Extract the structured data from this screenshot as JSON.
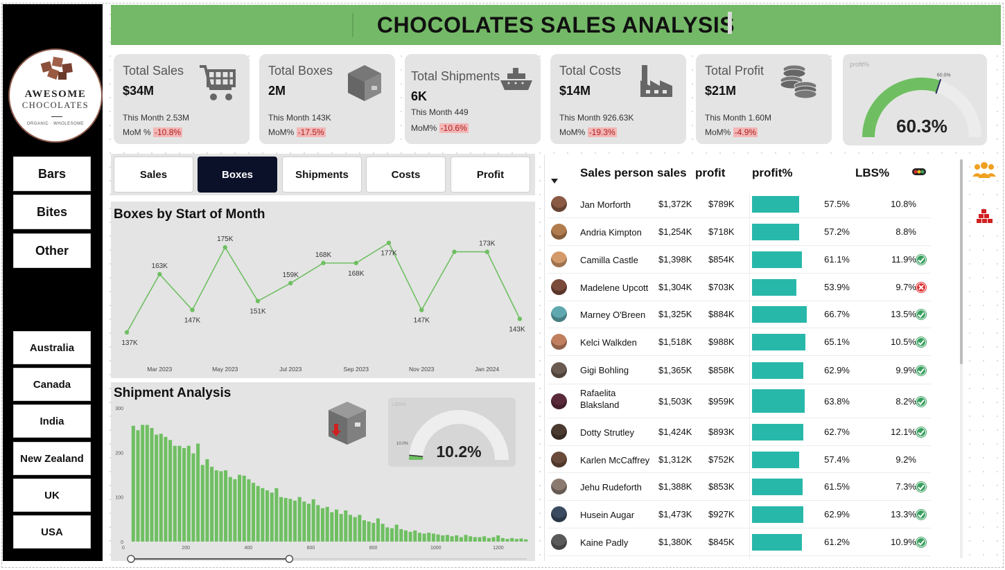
{
  "header": {
    "title": "CHOCOLATES SALES ANALYSIS"
  },
  "logo": {
    "line1": "AWESOME",
    "line2": "CHOCOLATES",
    "tagline": "ORGANIC · WHOLESOME"
  },
  "sidebar": {
    "products": [
      "Bars",
      "Bites",
      "Other"
    ],
    "countries": [
      "Australia",
      "Canada",
      "India",
      "New Zealand",
      "UK",
      "USA"
    ]
  },
  "kpis": [
    {
      "title": "Total Sales",
      "value": "$34M",
      "month_label": "This Month",
      "month_value": "2.53M",
      "mom_label": "MoM %",
      "mom_value": "-10.8%",
      "icon": "cart-icon"
    },
    {
      "title": "Total Boxes",
      "value": "2M",
      "month_label": "This Month",
      "month_value": "143K",
      "mom_label": "MoM%",
      "mom_value": "-17.5%",
      "icon": "box-icon"
    },
    {
      "title": "Total Shipments",
      "value": "6K",
      "month_label": "This Month",
      "month_value": "449",
      "mom_label": "MoM%",
      "mom_value": "-10.6%",
      "icon": "ship-icon"
    },
    {
      "title": "Total Costs",
      "value": "$14M",
      "month_label": "This Month",
      "month_value": "926.63K",
      "mom_label": "MoM%",
      "mom_value": "-19.3%",
      "icon": "factory-icon"
    },
    {
      "title": "Total Profit",
      "value": "$21M",
      "month_label": "This Month",
      "month_value": "1.60M",
      "mom_label": "MoM%",
      "mom_value": "-4.9%",
      "icon": "coins-icon"
    }
  ],
  "profit_gauge": {
    "label": "profit%",
    "value": "60.3%",
    "target": "60.0%",
    "fraction": 0.603
  },
  "tabs": {
    "items": [
      "Sales",
      "Boxes",
      "Shipments",
      "Costs",
      "Profit"
    ],
    "active": "Boxes"
  },
  "boxes_chart": {
    "title": "Boxes by Start of Month"
  },
  "shipment": {
    "title": "Shipment Analysis",
    "gauge_label": "LBS%",
    "gauge_value": "10.2%",
    "gauge_target": "10.0%",
    "gauge_fraction": 0.102,
    "slider_fraction": 0.4
  },
  "table": {
    "headers": {
      "name": "Sales person",
      "sales": "sales",
      "profit": "profit",
      "profit_pct": "profit%",
      "lbs": "LBS%"
    },
    "rows": [
      {
        "name": "Jan Morforth",
        "sales": "$1,372K",
        "profit": "$789K",
        "profit_pct": "57.5%",
        "pct": 57.5,
        "lbs": "10.8%",
        "status": "none",
        "avatar": "#8a5a44"
      },
      {
        "name": "Andria Kimpton",
        "sales": "$1,254K",
        "profit": "$718K",
        "profit_pct": "57.2%",
        "pct": 57.2,
        "lbs": "8.8%",
        "status": "none",
        "avatar": "#b07c4e"
      },
      {
        "name": "Camilla Castle",
        "sales": "$1,398K",
        "profit": "$854K",
        "profit_pct": "61.1%",
        "pct": 61.1,
        "lbs": "11.9%",
        "status": "ok",
        "avatar": "#d49a6a"
      },
      {
        "name": "Madelene Upcott",
        "sales": "$1,304K",
        "profit": "$703K",
        "profit_pct": "53.9%",
        "pct": 53.9,
        "lbs": "9.7%",
        "status": "bad",
        "avatar": "#7a4a3a"
      },
      {
        "name": "Marney O'Breen",
        "sales": "$1,325K",
        "profit": "$884K",
        "profit_pct": "66.7%",
        "pct": 66.7,
        "lbs": "13.5%",
        "status": "ok",
        "avatar": "#5fa8b0"
      },
      {
        "name": "Kelci Walkden",
        "sales": "$1,518K",
        "profit": "$988K",
        "profit_pct": "65.1%",
        "pct": 65.1,
        "lbs": "10.5%",
        "status": "ok",
        "avatar": "#c08060"
      },
      {
        "name": "Gigi Bohling",
        "sales": "$1,365K",
        "profit": "$858K",
        "profit_pct": "62.9%",
        "pct": 62.9,
        "lbs": "9.9%",
        "status": "ok",
        "avatar": "#6a5a50"
      },
      {
        "name": "Rafaelita Blaksland",
        "sales": "$1,503K",
        "profit": "$959K",
        "profit_pct": "63.8%",
        "pct": 63.8,
        "lbs": "8.2%",
        "status": "ok",
        "avatar": "#5a2a3a"
      },
      {
        "name": "Dotty Strutley",
        "sales": "$1,424K",
        "profit": "$893K",
        "profit_pct": "62.7%",
        "pct": 62.7,
        "lbs": "12.1%",
        "status": "ok",
        "avatar": "#4a3a30"
      },
      {
        "name": "Karlen McCaffrey",
        "sales": "$1,312K",
        "profit": "$752K",
        "profit_pct": "57.4%",
        "pct": 57.4,
        "lbs": "9.2%",
        "status": "none",
        "avatar": "#6a4a3a"
      },
      {
        "name": "Jehu Rudeforth",
        "sales": "$1,388K",
        "profit": "$853K",
        "profit_pct": "61.5%",
        "pct": 61.5,
        "lbs": "7.3%",
        "status": "ok",
        "avatar": "#8a7a70"
      },
      {
        "name": "Husein Augar",
        "sales": "$1,473K",
        "profit": "$927K",
        "profit_pct": "62.9%",
        "pct": 62.9,
        "lbs": "13.3%",
        "status": "ok",
        "avatar": "#3a4a60"
      },
      {
        "name": "Kaine Padly",
        "sales": "$1,380K",
        "profit": "$845K",
        "profit_pct": "61.2%",
        "pct": 61.2,
        "lbs": "10.9%",
        "status": "ok",
        "avatar": "#5a5a5a"
      }
    ]
  },
  "colors": {
    "header_green": "#74b967",
    "line_green": "#6fbf62",
    "teal": "#28b8aa",
    "ok": "#3aa060",
    "bad": "#e03030"
  },
  "chart_data": [
    {
      "type": "line",
      "title": "Boxes by Start of Month",
      "x": [
        "Feb 2023",
        "Mar 2023",
        "Apr 2023",
        "May 2023",
        "Jun 2023",
        "Jul 2023",
        "Aug 2023",
        "Sep 2023",
        "Oct 2023",
        "Nov 2023",
        "Dec 2023",
        "Jan 2024",
        "Feb 2024"
      ],
      "xticks": [
        "Mar 2023",
        "May 2023",
        "Jul 2023",
        "Sep 2023",
        "Nov 2023",
        "Jan 2024"
      ],
      "values": [
        137,
        163,
        147,
        175,
        151,
        159,
        168,
        168,
        177,
        147,
        173,
        173,
        143
      ],
      "labels": [
        "137K",
        "163K",
        "147K",
        "175K",
        "151K",
        "159K",
        "168K",
        "168K",
        "177K",
        "147K",
        "",
        "173K",
        "143K"
      ],
      "ylim": [
        132,
        180
      ]
    },
    {
      "type": "bar",
      "title": "Shipment Analysis",
      "xlim": [
        0,
        1300
      ],
      "xticks": [
        0,
        200,
        400,
        600,
        800,
        1000,
        1200
      ],
      "ylim": [
        0,
        300
      ],
      "yticks": [
        0,
        100,
        200,
        300
      ],
      "values": [
        260,
        250,
        262,
        262,
        255,
        240,
        242,
        235,
        228,
        215,
        215,
        210,
        215,
        198,
        220,
        172,
        185,
        168,
        160,
        158,
        160,
        145,
        140,
        150,
        148,
        140,
        132,
        125,
        120,
        115,
        110,
        120,
        100,
        98,
        96,
        92,
        100,
        90,
        85,
        95,
        82,
        75,
        78,
        66,
        72,
        62,
        70,
        60,
        55,
        60,
        48,
        45,
        42,
        52,
        40,
        32,
        30,
        38,
        28,
        25,
        22,
        25,
        20,
        18,
        20,
        18,
        16,
        14,
        15,
        12,
        14,
        10,
        15,
        12,
        10,
        10,
        12,
        8,
        10,
        14,
        8,
        6,
        8,
        6,
        7,
        5
      ]
    }
  ]
}
